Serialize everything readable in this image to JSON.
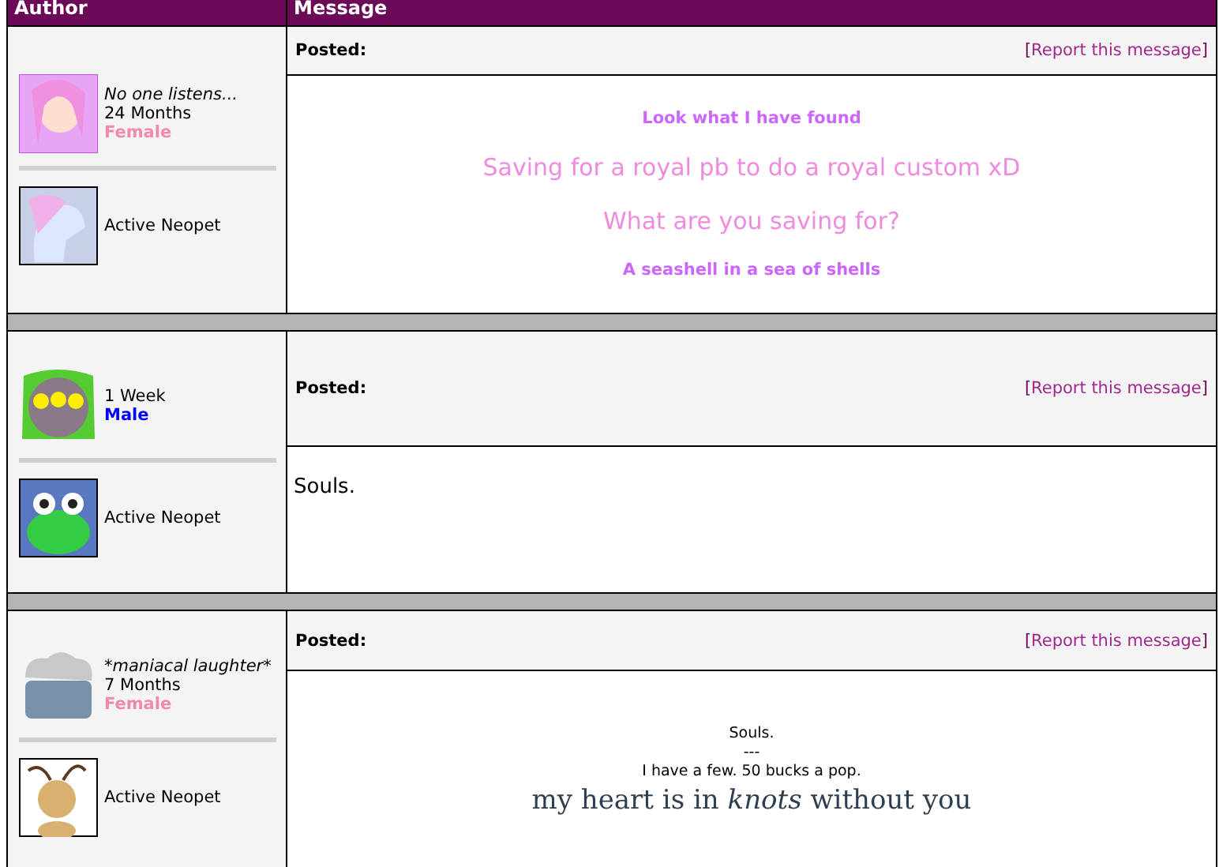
{
  "table": {
    "columns": [
      "Author",
      "Message"
    ]
  },
  "posts": [
    {
      "author": {
        "title": "No one listens...",
        "age": "24 Months",
        "gender": {
          "text": "Female",
          "color": "#f08aa6"
        },
        "pet_status": "Active Neopet"
      },
      "posted_label": "Posted:",
      "report": {
        "open": "[",
        "link": "Report this message",
        "close": "]"
      },
      "lines": [
        {
          "text": "Look what I have found",
          "kind": "small",
          "color": "#cc66ff"
        },
        {
          "text": "Saving for a royal pb to do a royal custom xD",
          "kind": "large",
          "color": "#f08ade"
        },
        {
          "text": "What are you saving for?",
          "kind": "large",
          "color": "#f08ade"
        },
        {
          "text": "A seashell in a sea of shells",
          "kind": "small",
          "color": "#cc66ff"
        }
      ]
    },
    {
      "author": {
        "age": "1 Week",
        "gender": {
          "text": "Male",
          "color": "#0000ff"
        },
        "pet_status": "Active Neopet"
      },
      "posted_label": "Posted:",
      "report": {
        "open": "[",
        "link": "Report this message",
        "close": "]"
      },
      "lines": [
        {
          "text": "Souls.",
          "kind": "plain",
          "color": "#000000"
        }
      ]
    },
    {
      "author": {
        "title": "*maniacal laughter*",
        "age": "7 Months",
        "gender": {
          "text": "Female",
          "color": "#f08aa6"
        },
        "pet_status": "Active Neopet"
      },
      "posted_label": "Posted:",
      "report": {
        "open": "[",
        "link": "Report this message",
        "close": "]"
      },
      "lines": [
        {
          "text": "Souls.",
          "kind": "tiny",
          "color": "#000000"
        },
        {
          "text": "---",
          "kind": "tiny",
          "color": "#000000"
        },
        {
          "text": "I have a few. 50 bucks a pop.",
          "kind": "tiny",
          "color": "#000000"
        },
        {
          "text": "my heart is in *knots* without you",
          "kind": "serif",
          "color": "#2f3f4f"
        }
      ]
    }
  ]
}
